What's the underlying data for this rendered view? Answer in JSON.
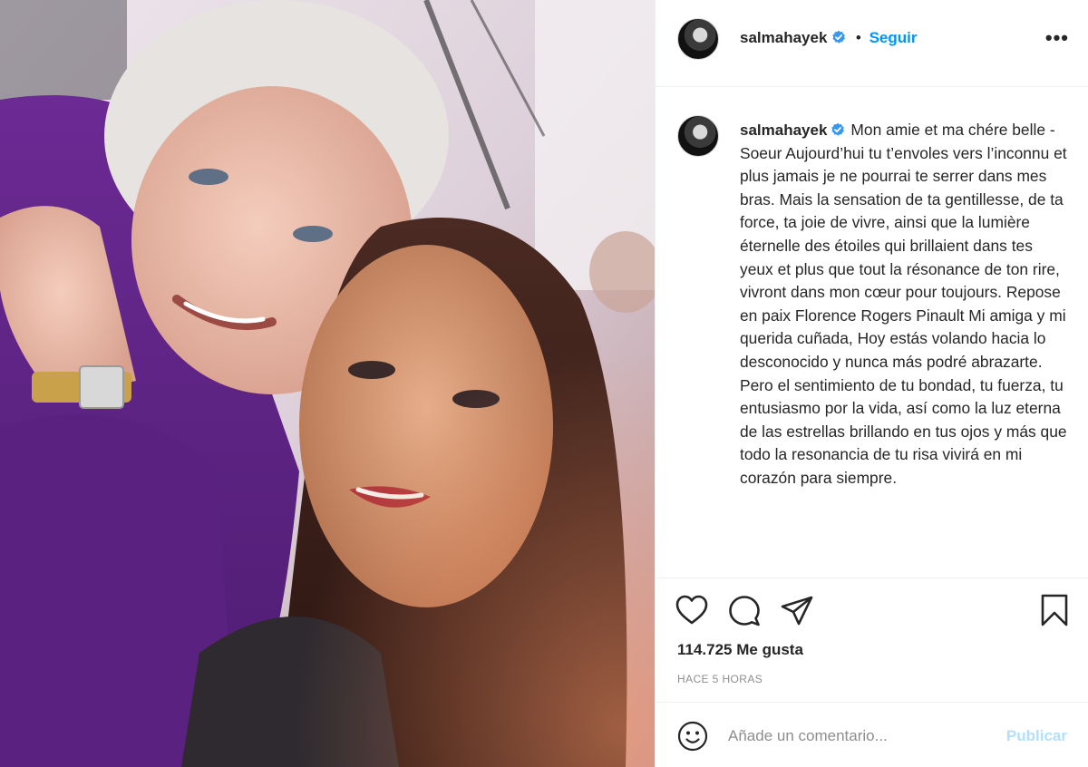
{
  "post": {
    "username": "salmahayek",
    "verified": true,
    "separator": "•",
    "follow_label": "Seguir",
    "more_label": "•••",
    "caption": "Mon amie et ma chére belle -Soeur Aujourd’hui tu t’envoles vers l’inconnu et plus jamais je ne pourrai te serrer dans mes bras. Mais la sensation de ta gentillesse, de ta force, ta joie de vivre, ainsi que la lumière éternelle des étoiles qui brillaient dans tes yeux et plus que tout la résonance de ton rire, vivront dans mon cœur pour toujours. Repose en paix Florence Rogers Pinault Mi amiga y mi querida cuñada, Hoy estás volando hacia lo desconocido y nunca más podré abrazarte. Pero el sentimiento de tu bondad, tu fuerza, tu entusiasmo por la vida, así como la luz eterna de las estrellas brillando en tus ojos y más que todo la resonancia de tu risa vivirá en mi corazón para siempre.",
    "likes_label": "114.725 Me gusta",
    "time_label": "HACE 5 HORAS"
  },
  "actions": {
    "like_icon": "heart-icon",
    "comment_icon": "comment-icon",
    "share_icon": "paper-plane-icon",
    "save_icon": "bookmark-icon"
  },
  "comment": {
    "placeholder": "Añade un comentario...",
    "publish_label": "Publicar",
    "emoji_icon": "smiley-icon"
  },
  "colors": {
    "link_blue": "#0095f6",
    "publish_disabled": "#b2dffc",
    "muted_text": "#8e8e8e",
    "text": "#262626",
    "divider": "#efefef"
  }
}
